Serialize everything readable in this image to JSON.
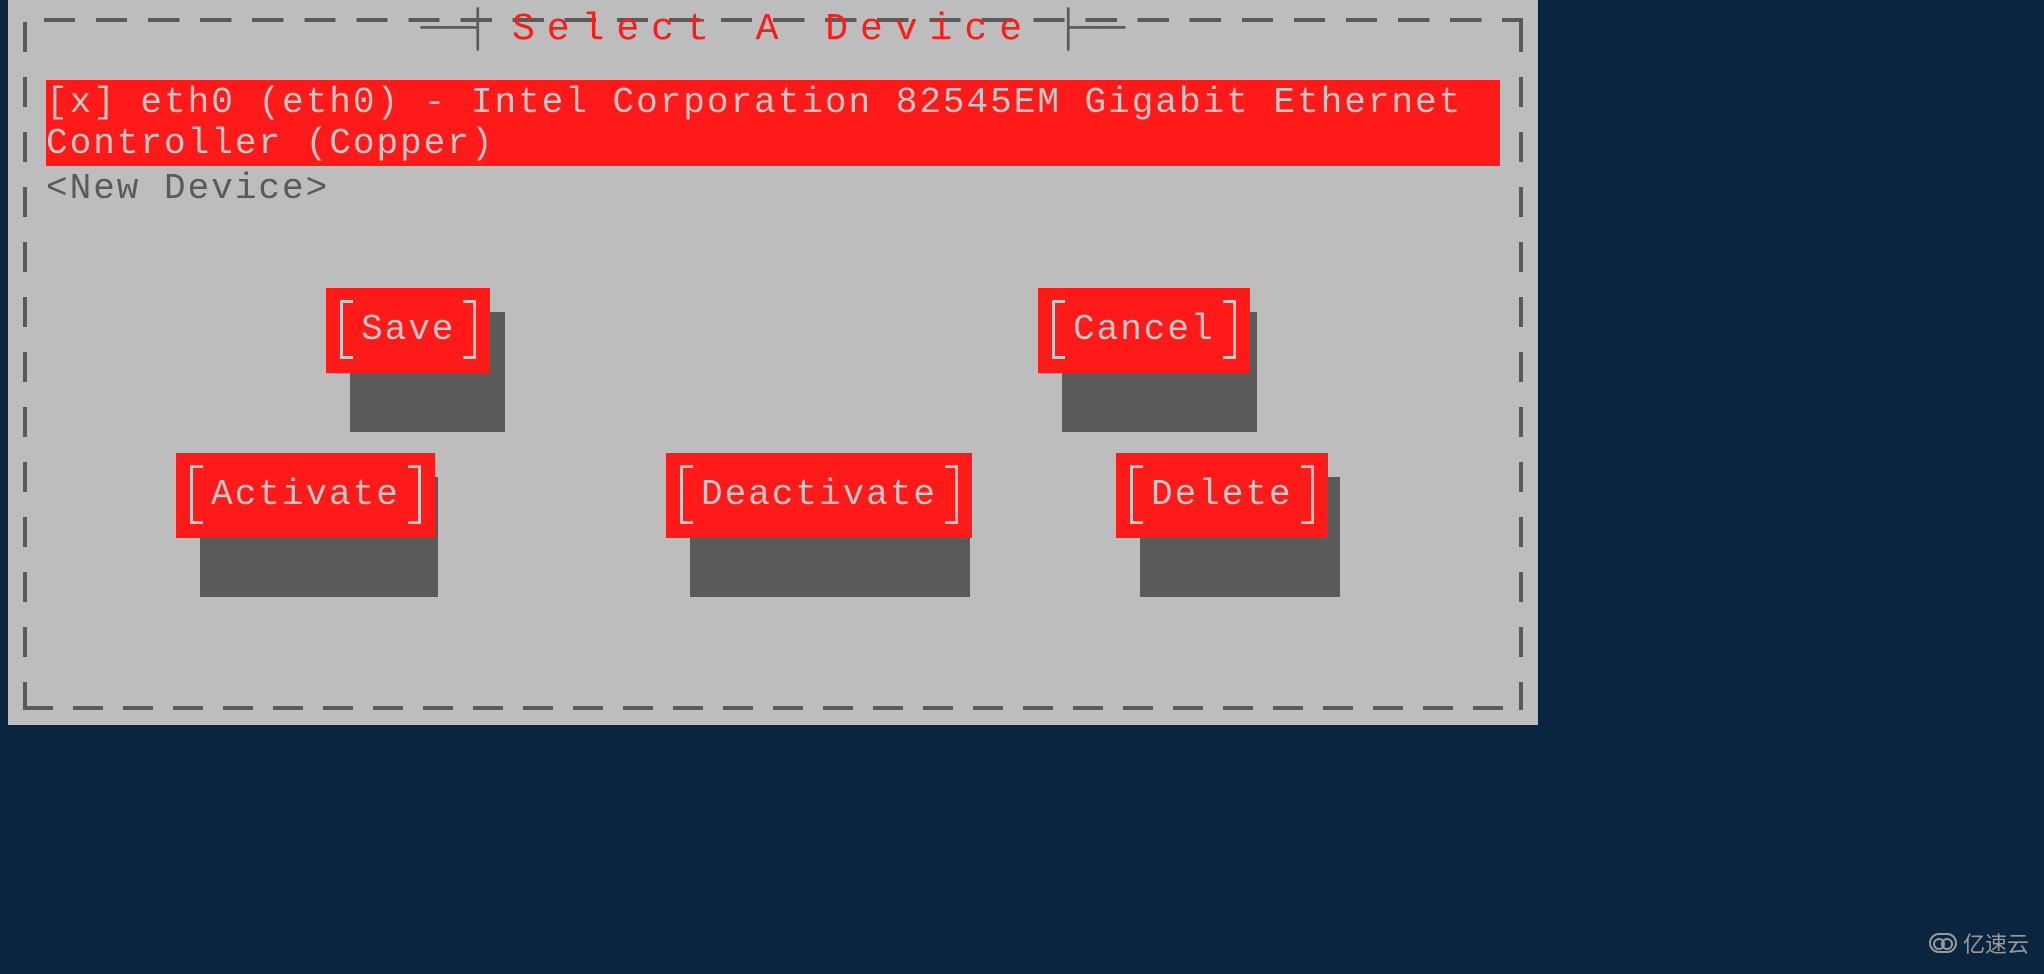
{
  "title": "Select A Device",
  "devices": {
    "selected": "[x] eth0 (eth0) - Intel Corporation 82545EM Gigabit Ethernet Controller (Copper)",
    "new": "<New Device>"
  },
  "buttons": {
    "save": "Save",
    "cancel": "Cancel",
    "activate": "Activate",
    "deactivate": "Deactivate",
    "delete": "Delete"
  },
  "watermark": "亿速云",
  "colors": {
    "accent": "#ff1a1a",
    "panel": "#bdbdbd",
    "border": "#5a5a5a",
    "text_light": "#c8c8c8"
  }
}
